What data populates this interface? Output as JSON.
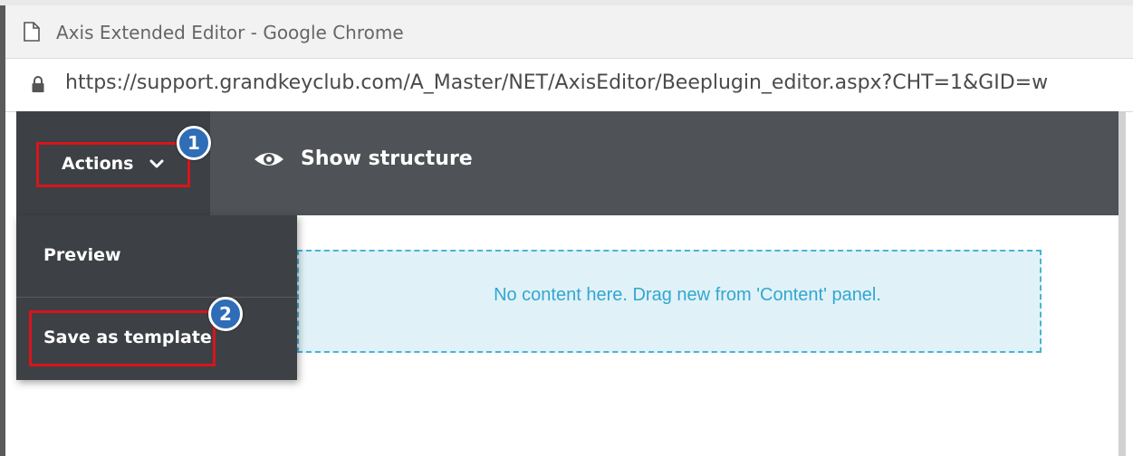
{
  "browser": {
    "window_title": "Axis Extended Editor - Google Chrome",
    "url": "https://support.grandkeyclub.com/A_Master/NET/AxisEditor/Beeplugin_editor.aspx?CHT=1&GID=w"
  },
  "toolbar": {
    "actions_label": "Actions",
    "show_structure_label": "Show structure"
  },
  "actions_menu": {
    "items": [
      {
        "label": "Preview"
      },
      {
        "label": "Save as template"
      }
    ]
  },
  "canvas": {
    "empty_message": "No content here. Drag new from 'Content' panel."
  },
  "annotations": {
    "step_1": "1",
    "step_2": "2"
  },
  "colors": {
    "toolbar_bg": "#4f5256",
    "menu_bg": "#3d4044",
    "dropzone_bg": "#e0f2f8",
    "dropzone_border": "#4ab3d3",
    "highlight_red": "#d9141c",
    "badge_blue": "#2f6db6"
  },
  "icons": {
    "title": "document-icon",
    "address": "lock-icon",
    "actions": "chevron-down-icon",
    "show_structure": "eye-icon"
  }
}
